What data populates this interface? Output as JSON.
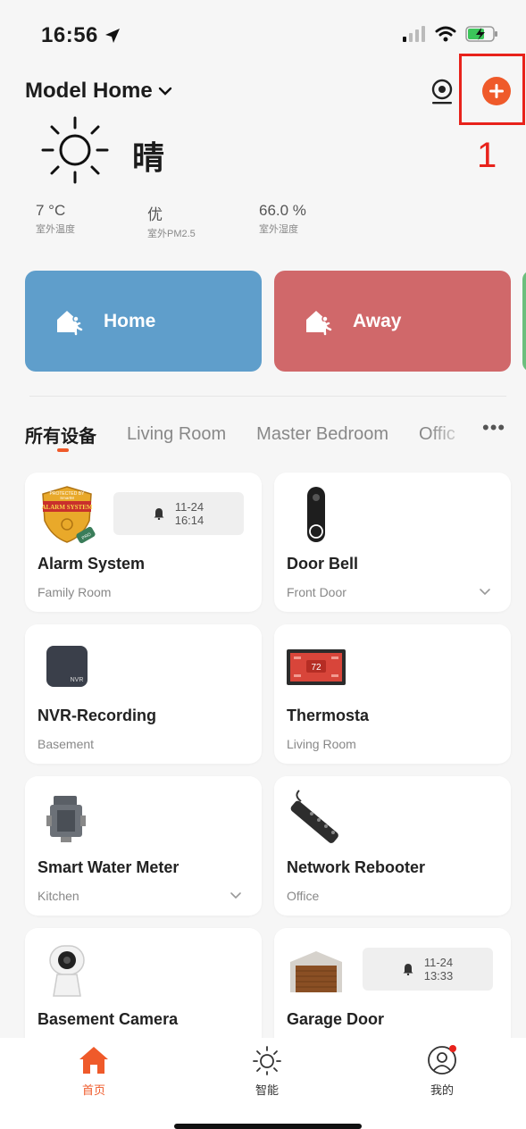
{
  "status_bar": {
    "time": "16:56"
  },
  "header": {
    "home_name": "Model Home"
  },
  "annotation": {
    "number": "1"
  },
  "weather": {
    "condition": "晴",
    "stats": [
      {
        "value": "7 °C",
        "label": "室外温度"
      },
      {
        "value": "优",
        "label": "室外PM2.5"
      },
      {
        "value": "66.0 %",
        "label": "室外湿度"
      }
    ]
  },
  "scenes": [
    {
      "label": "Home",
      "color": "#5f9ecb"
    },
    {
      "label": "Away",
      "color": "#d0686a"
    }
  ],
  "tabs": [
    "所有设备",
    "Living Room",
    "Master Bedroom",
    "Offic"
  ],
  "devices": [
    {
      "name": "Alarm System",
      "room": "Family Room",
      "badge_lines": [
        "PROTECTED BY",
        "SmartM",
        "ALARM SYSTEM",
        "PRO"
      ],
      "alert": {
        "line1": "11-24",
        "line2": "16:14"
      }
    },
    {
      "name": "Door Bell",
      "room": "Front Door"
    },
    {
      "name": "NVR-Recording",
      "room": "Basement",
      "thumb_text": "NVR"
    },
    {
      "name": "Thermosta",
      "room": "Living Room",
      "thumb_text": "72"
    },
    {
      "name": "Smart Water Meter",
      "room": "Kitchen"
    },
    {
      "name": "Network Rebooter",
      "room": "Office"
    },
    {
      "name": "Basement Camera",
      "room": ""
    },
    {
      "name": "Garage Door",
      "room": "",
      "alert": {
        "line1": "11-24",
        "line2": "13:33"
      }
    }
  ],
  "bottom_nav": [
    {
      "label": "首页",
      "icon": "home-icon",
      "active": true
    },
    {
      "label": "智能",
      "icon": "sun-icon",
      "active": false
    },
    {
      "label": "我的",
      "icon": "profile-icon",
      "active": false
    }
  ],
  "colors": {
    "accent": "#ef5a2a",
    "annotation": "#e8221b"
  }
}
